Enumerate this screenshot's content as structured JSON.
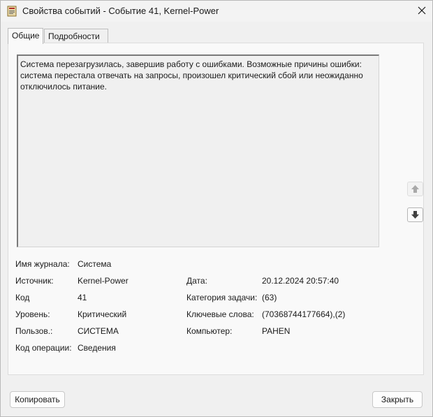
{
  "window": {
    "title": "Свойства событий - Событие 41, Kernel-Power"
  },
  "tabs": [
    {
      "label": "Общие",
      "active": true
    },
    {
      "label": "Подробности",
      "active": false
    }
  ],
  "description": "Система перезагрузилась, завершив работу с ошибками. Возможные причины ошибки: система перестала отвечать на запросы, произошел критический сбой или неожиданно отключилось питание.",
  "fields": {
    "log_name": {
      "label": "Имя журнала:",
      "value": "Система"
    },
    "source": {
      "label": "Источник:",
      "value": "Kernel-Power"
    },
    "event_id": {
      "label": "Код",
      "value": "41"
    },
    "level": {
      "label": "Уровень:",
      "value": "Критический"
    },
    "user": {
      "label": "Пользов.:",
      "value": "СИСТЕМА"
    },
    "opcode": {
      "label": "Код операции:",
      "value": "Сведения"
    },
    "date": {
      "label": "Дата:",
      "value": "20.12.2024 20:57:40"
    },
    "task_category": {
      "label": "Категория задачи:",
      "value": "(63)"
    },
    "keywords": {
      "label": "Ключевые слова:",
      "value": "(70368744177664),(2)"
    },
    "computer": {
      "label": "Компьютер:",
      "value": "PAHEN"
    }
  },
  "buttons": {
    "copy": "Копировать",
    "close": "Закрыть"
  },
  "icons": {
    "app": "event-viewer-icon",
    "close": "close-icon",
    "up": "arrow-up-icon",
    "down": "arrow-down-icon"
  }
}
